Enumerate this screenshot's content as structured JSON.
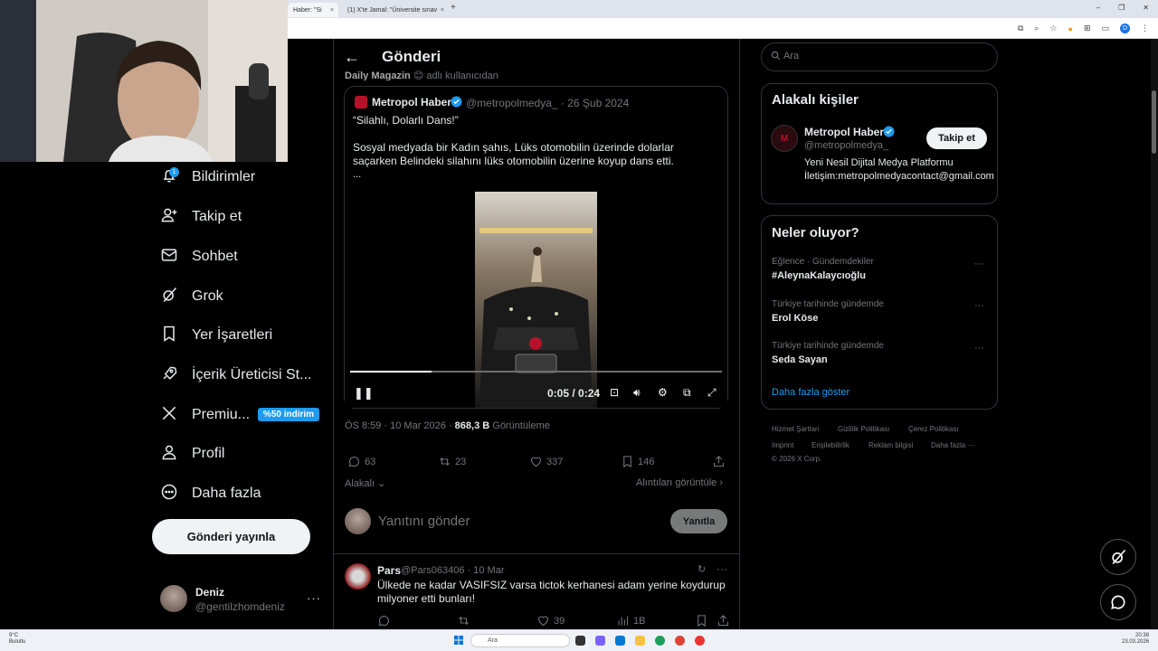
{
  "browser": {
    "tabs": [
      {
        "title": "Haber: \"Si"
      },
      {
        "title": "(1) X'te Jamal: \"Üniversite sınav"
      }
    ],
    "profile_initial": "D"
  },
  "nav": {
    "items": [
      {
        "label": "Bildirimler",
        "icon": "bell-icon",
        "badge": "1"
      },
      {
        "label": "Takip et",
        "icon": "person-add-icon"
      },
      {
        "label": "Sohbet",
        "icon": "mail-icon"
      },
      {
        "label": "Grok",
        "icon": "grok-icon"
      },
      {
        "label": "Yer İşaretleri",
        "icon": "bookmark-icon"
      },
      {
        "label": "İçerik Üreticisi St...",
        "icon": "rocket-icon"
      },
      {
        "label": "Premiu...",
        "icon": "x-logo-icon"
      },
      {
        "label": "Profil",
        "icon": "person-icon"
      },
      {
        "label": "Daha fazla",
        "icon": "more-circle-icon"
      }
    ],
    "premium_badge": "%50 indirim",
    "post_button": "Gönderi yayınla",
    "user": {
      "name": "Deniz",
      "handle": "@gentilzhomdeniz"
    }
  },
  "header": {
    "back": "←",
    "title": "Gönderi"
  },
  "faded_line": {
    "name": "Daily Magazin",
    "rest": "adlı kullanıcıdan"
  },
  "quoted_post": {
    "name": "Metropol Haber",
    "handle_date": "@metropolmedya_ · 26 Şub 2024",
    "title": "“Silahlı, Dolarlı Dans!”",
    "body": "Sosyal medyada bir Kadın şahıs, Lüks otomobilin üzerinde dolarlar saçarken Belindeki silahını lüks otomobilin üzerine koyup dans etti.",
    "ellipsis": "..."
  },
  "video": {
    "time": "0:05 / 0:24",
    "progress": 0.22
  },
  "post_meta": {
    "time": "ÖS 8:59 · 10 Mar 2026 · ",
    "views": "868,3 B",
    "views_label": " Görüntüleme"
  },
  "actions": {
    "replies": "63",
    "reposts": "23",
    "likes": "337",
    "bookmarks": "146"
  },
  "relevant": "Alakalı",
  "quotes_link": "Alıntıları görüntüle",
  "reply": {
    "placeholder": "Yanıtını gönder",
    "button": "Yanıtla"
  },
  "reply_post": {
    "name": "Pars",
    "handle_date": "@Pars063406 · 10 Mar",
    "text": "Ülkede ne kadar VASIFSIZ varsa tictok kerhanesi adam yerine koydurup milyoner etti bunları!",
    "likes": "39",
    "views": "1B"
  },
  "search": {
    "placeholder": "Ara"
  },
  "related": {
    "title": "Alakalı kişiler",
    "name": "Metropol Haber",
    "handle": "@metropolmedya_",
    "follow": "Takip et",
    "bio": "Yeni Nesil Dijital Medya Platformu İletişim:metropolmedyacontact@gmail.com"
  },
  "trends": {
    "title": "Neler oluyor?",
    "items": [
      {
        "category": "Eğlence · Gündemdekiler",
        "name": "#AleynaKalaycıoğlu"
      },
      {
        "category": "Türkiye tarihinde gündemde",
        "name": "Erol Köse"
      },
      {
        "category": "Türkiye tarihinde gündemde",
        "name": "Seda Sayan"
      }
    ],
    "show_more": "Daha fazla göster"
  },
  "footer": {
    "links": [
      "Hizmet Şartları",
      "Gizlilik Politikası",
      "Çerez Politikası",
      "Imprint",
      "Erişilebilirlik",
      "Reklam bilgisi",
      "Daha fazla ···"
    ],
    "copyright": "© 2026 X Corp."
  },
  "taskbar": {
    "weather_temp": "9°C",
    "weather_desc": "Bulutlu",
    "search": "Ara",
    "time": "20:38",
    "date": "23.03.2026"
  },
  "colors": {
    "accent": "#1d9bf0",
    "background": "#000000",
    "border": "#2f3336",
    "muted": "#71767b"
  }
}
